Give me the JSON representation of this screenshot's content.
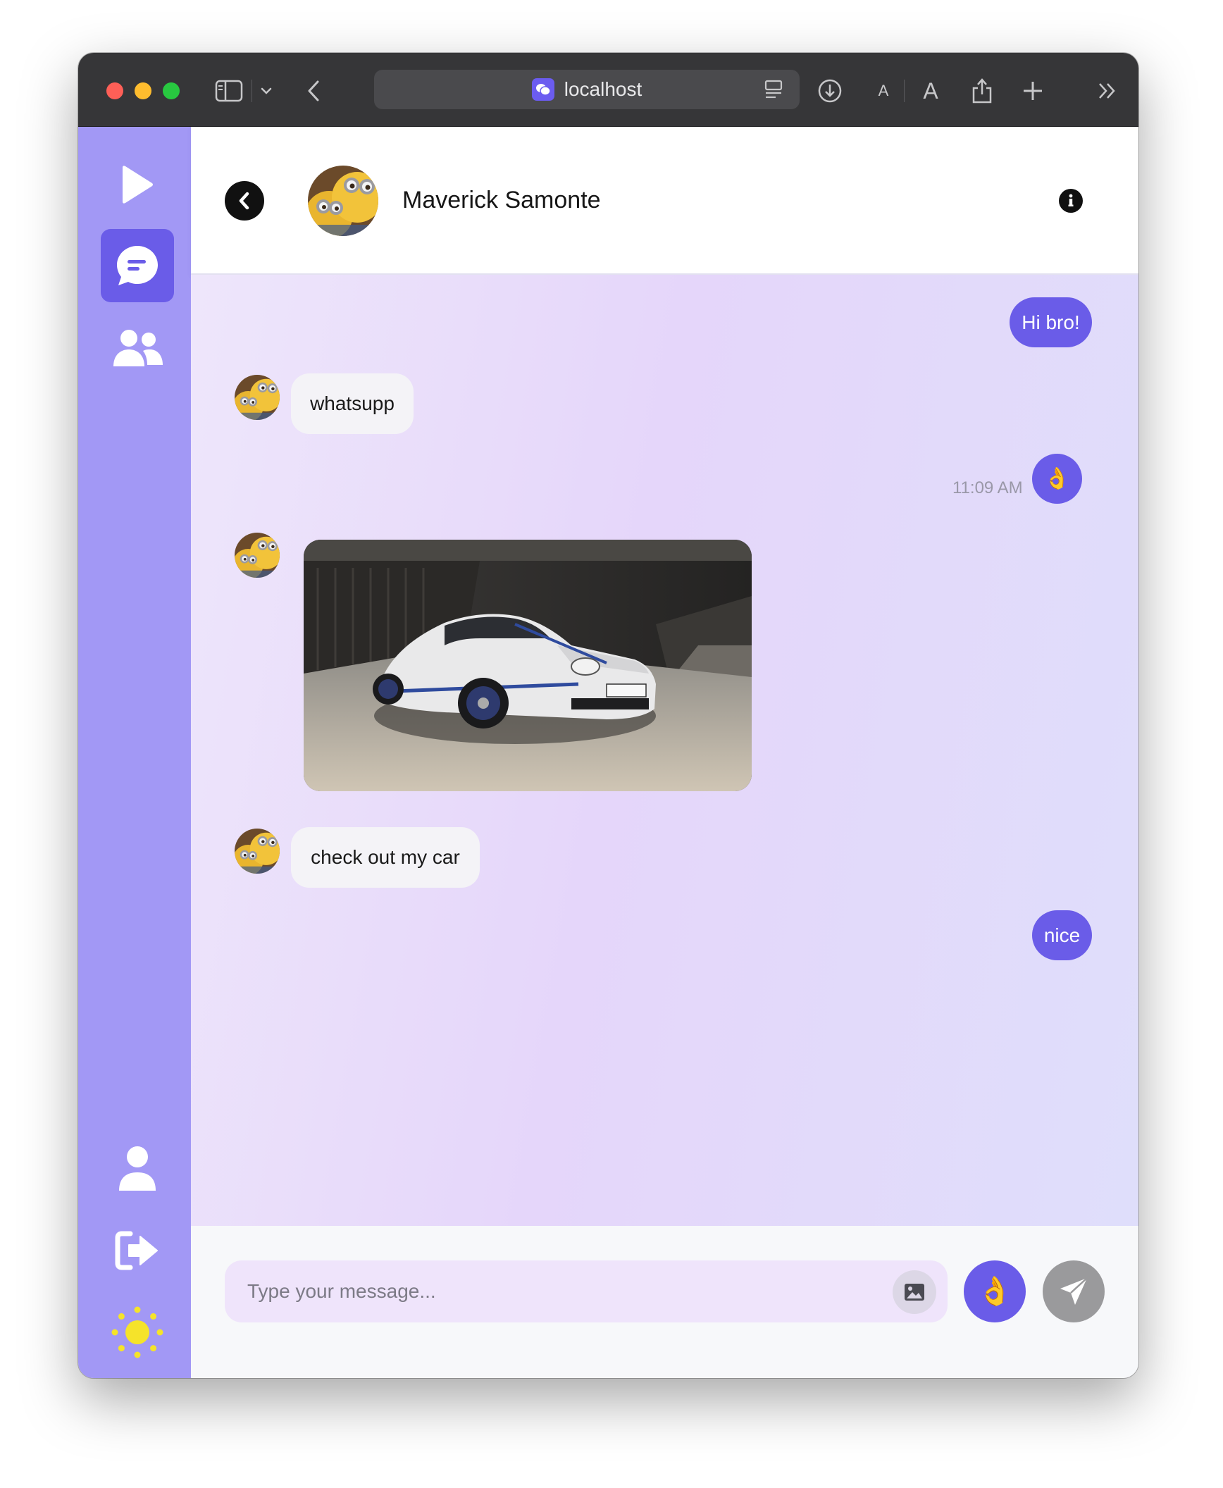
{
  "browser": {
    "address": "localhost",
    "font_small": "A",
    "font_large": "A"
  },
  "sidebar": {
    "items": [
      {
        "icon": "play-icon"
      },
      {
        "icon": "chat-bubble-icon",
        "active": true
      },
      {
        "icon": "users-icon"
      },
      {
        "icon": "user-icon"
      },
      {
        "icon": "logout-icon"
      },
      {
        "icon": "sun-icon"
      }
    ]
  },
  "chat": {
    "contact_name": "Maverick Samonte",
    "messages": [
      {
        "direction": "out",
        "text": "Hi bro!"
      },
      {
        "direction": "in",
        "text": "whatsupp"
      },
      {
        "direction": "out",
        "text": "👌",
        "time": "11:09 AM"
      },
      {
        "direction": "in",
        "type": "image",
        "alt": "car photo"
      },
      {
        "direction": "in",
        "text": "check out my car"
      },
      {
        "direction": "out",
        "text": "nice"
      }
    ]
  },
  "composer": {
    "placeholder": "Type your message...",
    "emoji": "👌"
  },
  "colors": {
    "accent": "#6a5ce8",
    "sidebar": "#a298f5",
    "sun": "#f5e32a"
  }
}
